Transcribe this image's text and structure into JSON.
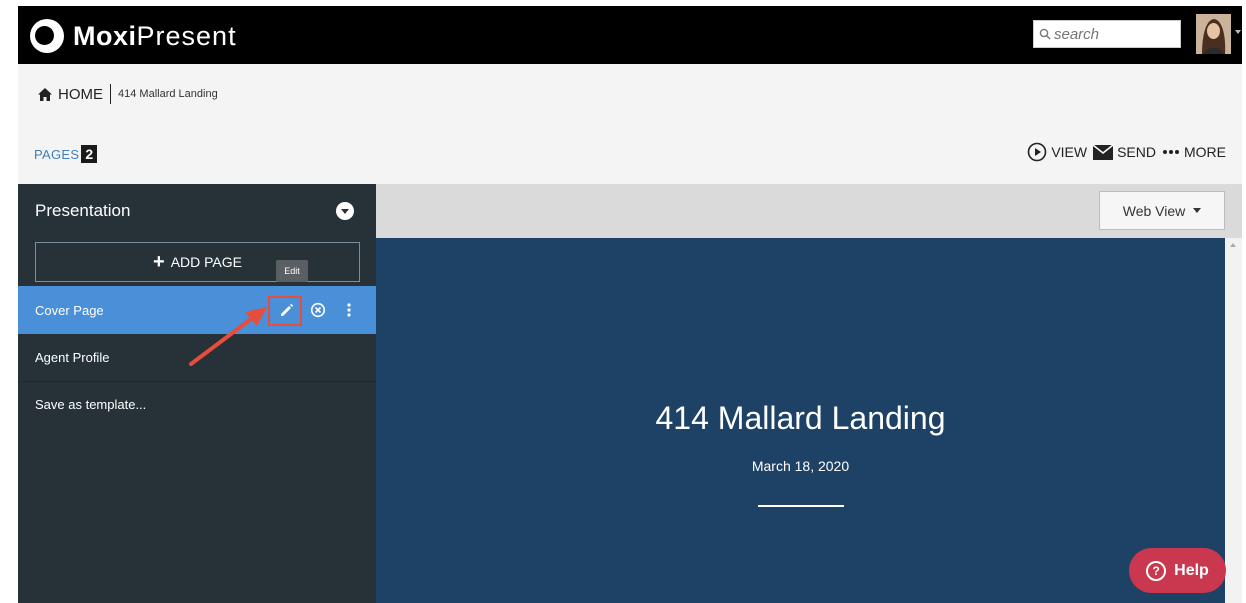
{
  "app": {
    "brand_bold": "Moxi",
    "brand_light": "Present"
  },
  "search": {
    "placeholder": "search"
  },
  "breadcrumb": {
    "home": "HOME",
    "current": "414 Mallard Landing"
  },
  "pages_tab": {
    "label": "PAGES",
    "count": "2"
  },
  "actions": {
    "view": "VIEW",
    "send": "SEND",
    "more": "MORE"
  },
  "sidebar": {
    "title": "Presentation",
    "add_page": "ADD PAGE",
    "items": [
      {
        "label": "Cover Page"
      },
      {
        "label": "Agent Profile"
      },
      {
        "label": "Save as template..."
      }
    ],
    "tooltip": "Edit"
  },
  "view_select": {
    "value": "Web View"
  },
  "preview": {
    "title": "414 Mallard Landing",
    "date": "March 18, 2020"
  },
  "help": {
    "label": "Help"
  },
  "colors": {
    "active_item": "#4a90d9",
    "sidebar_bg": "#263238",
    "preview_bg": "#1e4266",
    "help_bg": "#c9384e",
    "annotation": "#e84c3d"
  }
}
